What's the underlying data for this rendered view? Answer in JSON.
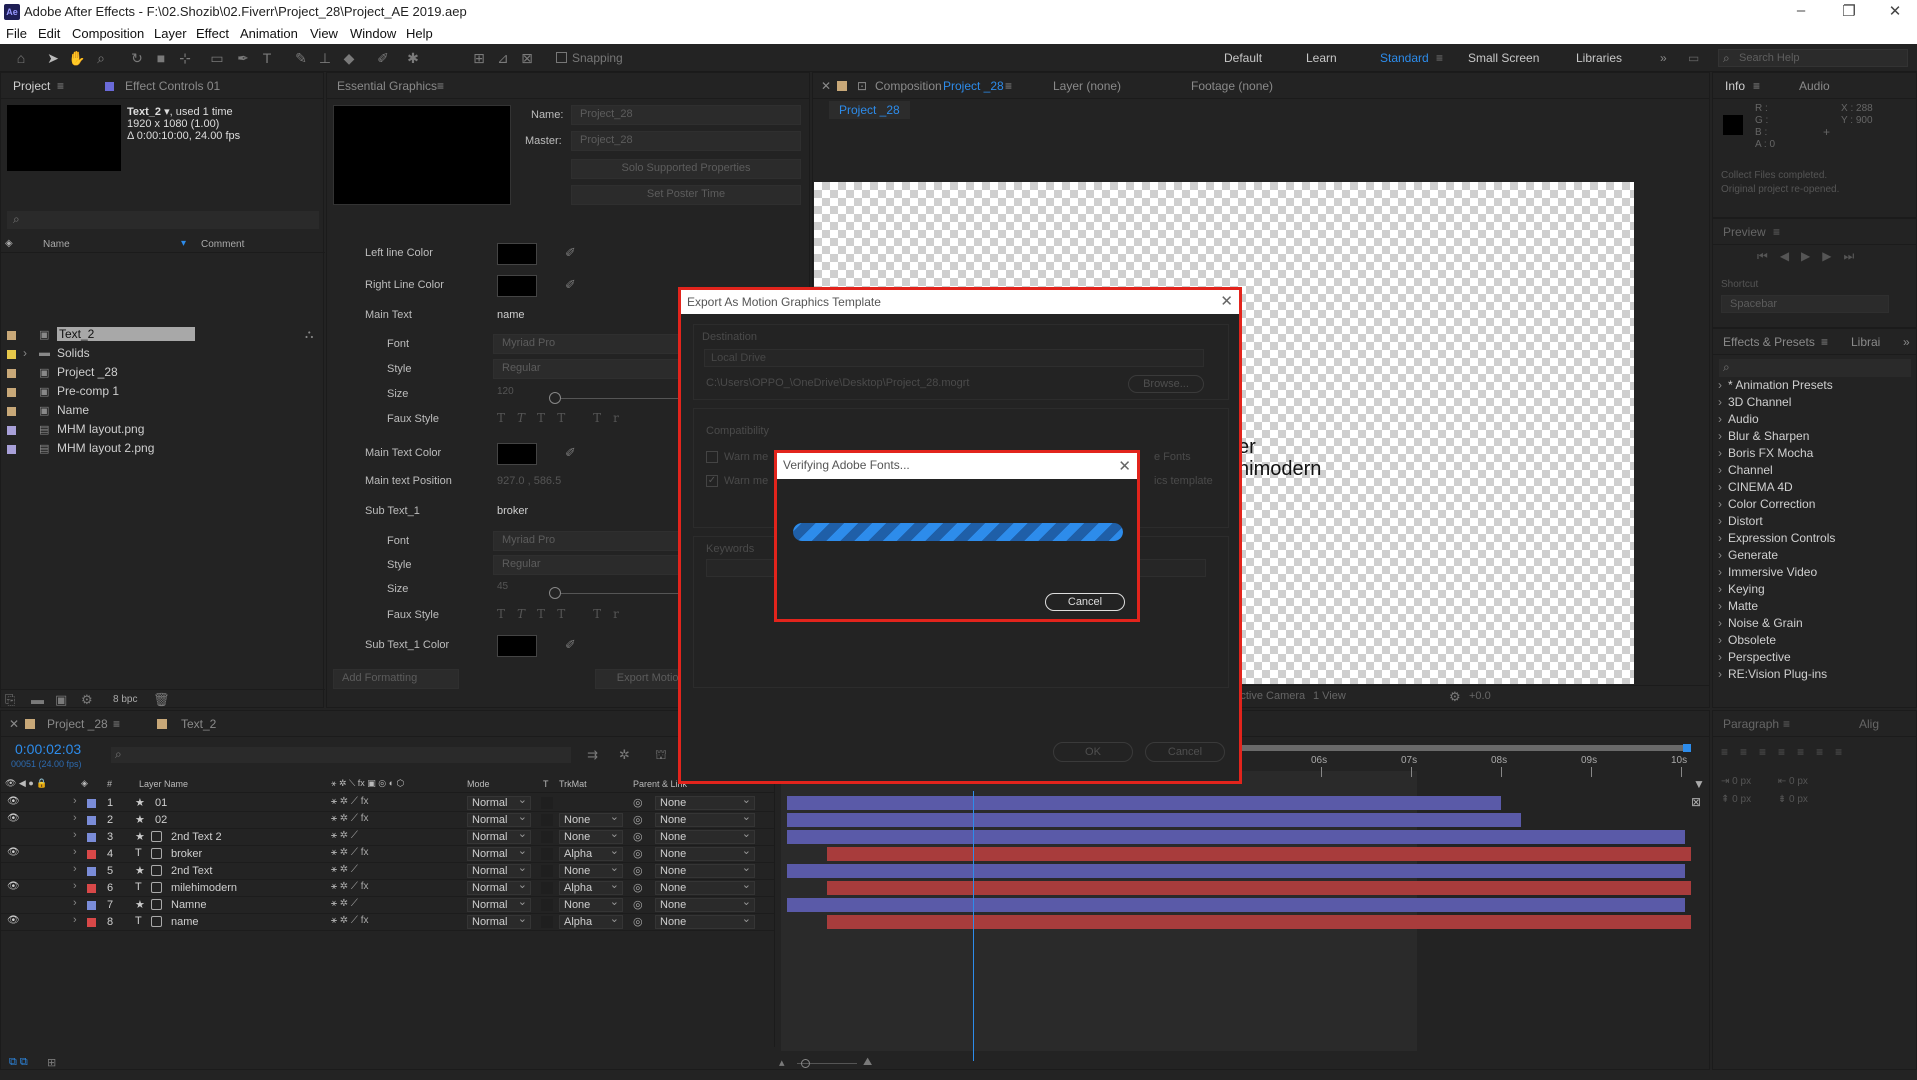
{
  "app": {
    "title": "Adobe After Effects - F:\\02.Shozib\\02.Fiverr\\Project_28\\Project_AE 2019.aep",
    "logo": "Ae"
  },
  "menu": [
    "File",
    "Edit",
    "Composition",
    "Layer",
    "Effect",
    "Animation",
    "View",
    "Window",
    "Help"
  ],
  "toolbar": {
    "snapping": "Snapping",
    "workspaces": [
      "Default",
      "Learn",
      "Standard",
      "Small Screen",
      "Libraries"
    ],
    "active_workspace": "Standard",
    "search_placeholder": "Search Help"
  },
  "project": {
    "tab": "Project",
    "tab2": "Effect Controls 01",
    "sel_name": "Text_2",
    "sel_used": ", used 1 time",
    "sel_dims": "1920 x 1080 (1.00)",
    "sel_dur": "Δ 0:00:10:00, 24.00 fps",
    "col_name": "Name",
    "col_comment": "Comment",
    "bpc": "8 bpc",
    "items": [
      {
        "name": "Text_2",
        "color": "#c8a878"
      },
      {
        "name": "Solids",
        "color": "#e6c84a"
      },
      {
        "name": "Project _28",
        "color": "#c8a878"
      },
      {
        "name": "Pre-comp 1",
        "color": "#c8a878"
      },
      {
        "name": "Name",
        "color": "#c8a878"
      },
      {
        "name": "MHM layout.png",
        "color": "#a8a0d8"
      },
      {
        "name": "MHM layout 2.png",
        "color": "#a8a0d8"
      }
    ]
  },
  "eg": {
    "tab": "Essential Graphics",
    "name_lbl": "Name:",
    "name_val": "Project_28",
    "master_lbl": "Master:",
    "master_val": "Project_28",
    "solo": "Solo Supported Properties",
    "poster": "Set Poster Time",
    "props": [
      {
        "label": "Left line Color",
        "type": "color"
      },
      {
        "label": "Right Line Color",
        "type": "color"
      },
      {
        "label": "Main Text",
        "type": "text",
        "value": "name"
      },
      {
        "label": "Font",
        "type": "sub",
        "value": "Myriad Pro"
      },
      {
        "label": "Style",
        "type": "sub",
        "value": "Regular"
      },
      {
        "label": "Size",
        "type": "size",
        "value": "120"
      },
      {
        "label": "Faux Style",
        "type": "faux"
      },
      {
        "label": "Main Text Color",
        "type": "color"
      },
      {
        "label": "Main text Position",
        "type": "text",
        "value": "927.0 , 586.5"
      },
      {
        "label": "Sub Text_1",
        "type": "text",
        "value": "broker"
      },
      {
        "label": "Font",
        "type": "sub",
        "value": "Myriad Pro"
      },
      {
        "label": "Style",
        "type": "sub",
        "value": "Regular"
      },
      {
        "label": "Size",
        "type": "size",
        "value": "45"
      },
      {
        "label": "Faux Style",
        "type": "faux"
      },
      {
        "label": "Sub Text_1 Color",
        "type": "color"
      }
    ],
    "add_formatting": "Add Formatting",
    "export": "Export Motion Graphics Template"
  },
  "comp": {
    "tab": "Composition",
    "comp_name": "Project _28",
    "layer_tab": "Layer (none)",
    "footage_tab": "Footage (none)",
    "crumb": "Project _28",
    "text1": "er",
    "text2": "nimodern",
    "camera": "Active Camera",
    "view": "1 View",
    "exposure": "+0.0"
  },
  "info": {
    "tab": "Info",
    "tab2": "Audio",
    "r": "R :",
    "g": "G :",
    "b": "B :",
    "a": "A : 0",
    "x": "X : 288",
    "y": "Y : 900",
    "msg1": "Collect Files completed.",
    "msg2": "Original project re-opened."
  },
  "preview": {
    "tab": "Preview",
    "shortcut_lbl": "Shortcut",
    "shortcut": "Spacebar"
  },
  "effects": {
    "tab": "Effects & Presets",
    "tab2": "Librai",
    "items": [
      "* Animation Presets",
      "3D Channel",
      "Audio",
      "Blur & Sharpen",
      "Boris FX Mocha",
      "Channel",
      "CINEMA 4D",
      "Color Correction",
      "Distort",
      "Expression Controls",
      "Generate",
      "Immersive Video",
      "Keying",
      "Matte",
      "Noise & Grain",
      "Obsolete",
      "Perspective",
      "RE:Vision Plug-ins"
    ]
  },
  "paragraph": {
    "tab": "Paragraph",
    "tab2": "Alig",
    "px": "0 px"
  },
  "timeline": {
    "tab": "Project _28",
    "tab2": "Text_2",
    "timecode": "0:00:02:03",
    "frames": "00051 (24.00 fps)",
    "cols": [
      "Layer Name",
      "Mode",
      "T",
      "TrkMat",
      "Parent & Link"
    ],
    "ticks": [
      "06s",
      "07s",
      "08s",
      "09s",
      "10s"
    ],
    "layers": [
      {
        "n": "1",
        "name": "01",
        "kind": "star",
        "color": "#7a8cd8",
        "mode": "Normal",
        "trk": "",
        "parent": "None",
        "bar": "#5a5aa8",
        "eye": true
      },
      {
        "n": "2",
        "name": "02",
        "kind": "star",
        "color": "#7a8cd8",
        "mode": "Normal",
        "trk": "None",
        "parent": "None",
        "bar": "#5a5aa8",
        "eye": true
      },
      {
        "n": "3",
        "name": "2nd Text 2",
        "kind": "star",
        "color": "#7a8cd8",
        "mode": "Normal",
        "trk": "None",
        "parent": "None",
        "bar": "#5a5aa8",
        "eye": false
      },
      {
        "n": "4",
        "name": "broker",
        "kind": "T",
        "color": "#d84848",
        "mode": "Normal",
        "trk": "Alpha",
        "parent": "None",
        "bar": "#a83c3c",
        "eye": true
      },
      {
        "n": "5",
        "name": "2nd Text",
        "kind": "star",
        "color": "#7a8cd8",
        "mode": "Normal",
        "trk": "None",
        "parent": "None",
        "bar": "#5a5aa8",
        "eye": false
      },
      {
        "n": "6",
        "name": "milehimodern",
        "kind": "T",
        "color": "#d84848",
        "mode": "Normal",
        "trk": "Alpha",
        "parent": "None",
        "bar": "#a83c3c",
        "eye": true
      },
      {
        "n": "7",
        "name": "Namne",
        "kind": "star",
        "color": "#7a8cd8",
        "mode": "Normal",
        "trk": "None",
        "parent": "None",
        "bar": "#5a5aa8",
        "eye": false
      },
      {
        "n": "8",
        "name": "name",
        "kind": "T",
        "color": "#d84848",
        "mode": "Normal",
        "trk": "Alpha",
        "parent": "None",
        "bar": "#a83c3c",
        "eye": true
      }
    ]
  },
  "export_dialog": {
    "title": "Export As Motion Graphics Template",
    "dest_lbl": "Destination",
    "dest_val": "Local Drive",
    "path": "C:\\Users\\OPPO_\\OneDrive\\Desktop\\Project_28.mogrt",
    "browse": "Browse...",
    "compat_lbl": "Compatibility",
    "warn1": "Warn me",
    "warn2": "Warn me",
    "warn1_tail": "e Fonts",
    "warn2_tail": "ics template",
    "keywords": "Keywords",
    "ok": "OK",
    "cancel": "Cancel"
  },
  "verify_dialog": {
    "title": "Verifying Adobe Fonts...",
    "cancel": "Cancel",
    "progress": 1.0
  },
  "colors": {
    "accent": "#2d8ceb",
    "highlight_border": "#e2241c"
  }
}
